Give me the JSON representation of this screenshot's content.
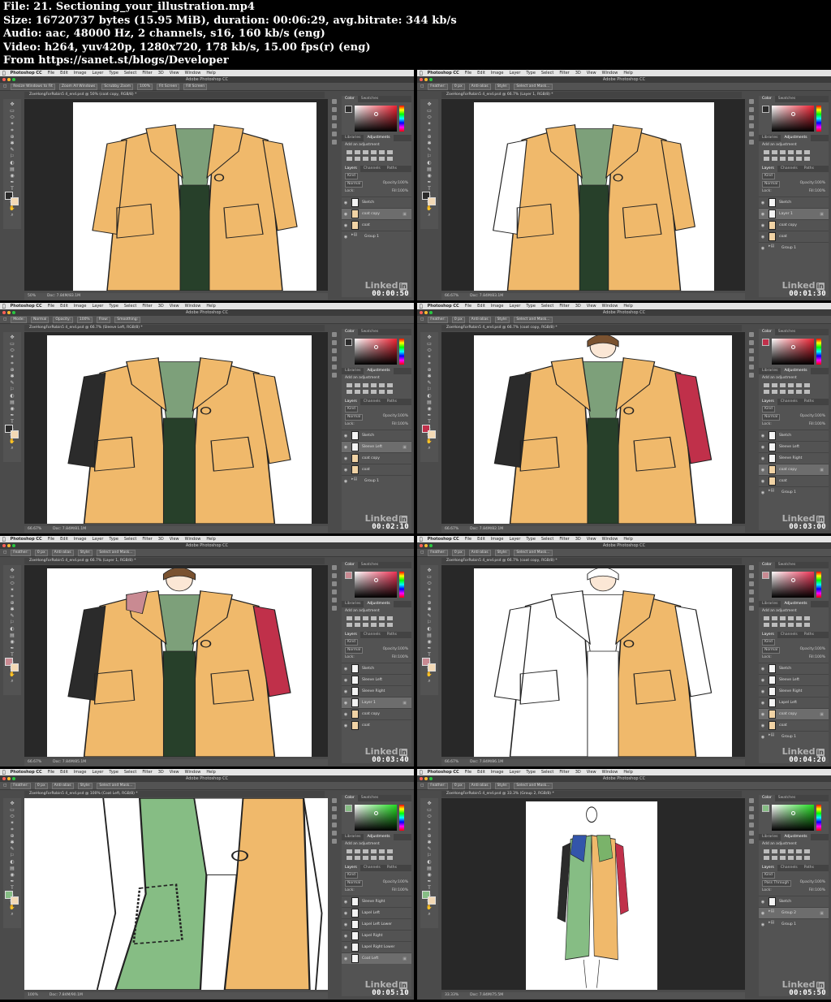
{
  "header": {
    "lines": [
      "File: 21. Sectioning_your_illustration.mp4",
      "Size: 16720737 bytes (15.95 MiB), duration: 00:06:29, avg.bitrate: 344 kb/s",
      "Audio: aac, 48000 Hz, 2 channels, s16, 160 kb/s (eng)",
      "Video: h264, yuv420p, 1280x720, 178 kb/s, 15.00 fps(r) (eng)",
      "From https://sanet.st/blogs/Developer"
    ]
  },
  "app": {
    "name": "Photoshop CC",
    "window_title": "Adobe Photoshop CC",
    "menu": [
      "File",
      "Edit",
      "Image",
      "Layer",
      "Type",
      "Select",
      "Filter",
      "3D",
      "View",
      "Window",
      "Help"
    ],
    "watermark": "Linked",
    "watermark_in": "in",
    "panel_tabs_top": [
      "Color",
      "Swatches"
    ],
    "panel_tabs_mid": [
      "Libraries",
      "Adjustments"
    ],
    "add_adjustment": "Add an adjustment",
    "panel_tabs_layers": [
      "Layers",
      "Channels",
      "Paths"
    ],
    "kind_label": "Kind",
    "opacity_label": "Opacity:",
    "opacity_value": "100%",
    "lock_label": "Lock:",
    "fill_label": "Fill:",
    "fill_value": "100%"
  },
  "frames": [
    {
      "timestamp": "00:00:50",
      "doc_tab": "ZoeHongForRobin5 4_end.psd @ 50% (coat copy, RGB/8) *",
      "zoom": "50%",
      "doc_size": "Doc: 7.84M/83.1M",
      "blend": "Normal",
      "options": [
        "Resize Windows to Fit",
        "Zoom All Windows",
        "Scrubby Zoom",
        "100%",
        "Fit Screen",
        "Fill Screen"
      ],
      "picker": "red",
      "fg": "#2b2b2b",
      "layers": [
        {
          "name": "Sketch",
          "type": "sketch"
        },
        {
          "name": "coat copy",
          "type": "coat",
          "selected": true
        },
        {
          "name": "coat",
          "type": "coat"
        },
        {
          "name": "Group 1",
          "type": "folder"
        }
      ]
    },
    {
      "timestamp": "00:01:30",
      "doc_tab": "ZoeHongForRobin5 4_end.psd @ 66.7% (Layer 1, RGB/8) *",
      "zoom": "66.67%",
      "doc_size": "Doc: 7.84M/83.1M",
      "blend": "Normal",
      "options": [
        "Feather:",
        "0 px",
        "Anti-alias",
        "Style:",
        "Select and Mask..."
      ],
      "picker": "red",
      "fg": "#2b2b2b",
      "layers": [
        {
          "name": "Sketch",
          "type": "sketch"
        },
        {
          "name": "Layer 1",
          "type": "sketch",
          "selected": true
        },
        {
          "name": "coat copy",
          "type": "coat"
        },
        {
          "name": "coat",
          "type": "coat"
        },
        {
          "name": "Group 1",
          "type": "folder"
        }
      ]
    },
    {
      "timestamp": "00:02:10",
      "doc_tab": "ZoeHongForRobin5 4_end.psd @ 66.7% (Sleeve Left, RGB/8) *",
      "zoom": "66.67%",
      "doc_size": "Doc: 7.84M/81.1M",
      "blend": "Normal",
      "options": [
        "Mode:",
        "Normal",
        "Opacity:",
        "100%",
        "Flow:",
        "Smoothing:"
      ],
      "picker": "red",
      "fg": "#2b2b2b",
      "layers": [
        {
          "name": "Sketch",
          "type": "sketch"
        },
        {
          "name": "Sleeve Left",
          "type": "sketch",
          "selected": true
        },
        {
          "name": "coat copy",
          "type": "coat"
        },
        {
          "name": "coat",
          "type": "coat"
        },
        {
          "name": "Group 1",
          "type": "folder"
        }
      ]
    },
    {
      "timestamp": "00:03:00",
      "doc_tab": "ZoeHongForRobin5 4_end.psd @ 66.7% (coat copy, RGB/8) *",
      "zoom": "66.67%",
      "doc_size": "Doc: 7.84M/82.1M",
      "blend": "Normal",
      "options": [
        "Feather:",
        "0 px",
        "Anti-alias",
        "Style:",
        "Select and Mask..."
      ],
      "picker": "red",
      "fg": "#c0304a",
      "layers": [
        {
          "name": "Sketch",
          "type": "sketch"
        },
        {
          "name": "Sleeve Left",
          "type": "sketch"
        },
        {
          "name": "Sleeve Right",
          "type": "sketch"
        },
        {
          "name": "coat copy",
          "type": "coat",
          "selected": true
        },
        {
          "name": "coat",
          "type": "coat"
        },
        {
          "name": "Group 1",
          "type": "folder"
        }
      ]
    },
    {
      "timestamp": "00:03:40",
      "doc_tab": "ZoeHongForRobin5 4_end.psd @ 66.7% (Layer 1, RGB/8) *",
      "zoom": "66.67%",
      "doc_size": "Doc: 7.84M/85.1M",
      "blend": "Normal",
      "options": [
        "Feather:",
        "0 px",
        "Anti-alias",
        "Style:",
        "Select and Mask..."
      ],
      "picker": "pink",
      "fg": "#c98a92",
      "layers": [
        {
          "name": "Sketch",
          "type": "sketch"
        },
        {
          "name": "Sleeve Left",
          "type": "sketch"
        },
        {
          "name": "Sleeve Right",
          "type": "sketch"
        },
        {
          "name": "Layer 1",
          "type": "sketch",
          "selected": true
        },
        {
          "name": "coat copy",
          "type": "coat"
        },
        {
          "name": "coat",
          "type": "coat"
        }
      ]
    },
    {
      "timestamp": "00:04:20",
      "doc_tab": "ZoeHongForRobin5 4_end.psd @ 66.7% (coat copy, RGB/8) *",
      "zoom": "66.67%",
      "doc_size": "Doc: 7.84M/86.1M",
      "blend": "Normal",
      "options": [
        "Feather:",
        "0 px",
        "Anti-alias",
        "Style:",
        "Select and Mask..."
      ],
      "picker": "pink",
      "fg": "#c98a92",
      "layers": [
        {
          "name": "Sketch",
          "type": "sketch"
        },
        {
          "name": "Sleeve Left",
          "type": "sketch"
        },
        {
          "name": "Sleeve Right",
          "type": "sketch"
        },
        {
          "name": "Lapel Left",
          "type": "sketch"
        },
        {
          "name": "coat copy",
          "type": "coat",
          "selected": true
        },
        {
          "name": "coat",
          "type": "coat"
        },
        {
          "name": "Group 1",
          "type": "folder"
        }
      ]
    },
    {
      "timestamp": "00:05:10",
      "doc_tab": "ZoeHongForRobin5 4_end.psd @ 100% (Coat Left, RGB/8) *",
      "zoom": "100%",
      "doc_size": "Doc: 7.84M/90.1M",
      "blend": "Normal",
      "options": [
        "Feather:",
        "0 px",
        "Anti-alias",
        "Style:",
        "Select and Mask..."
      ],
      "picker": "green",
      "fg": "#86bd84",
      "layers": [
        {
          "name": "Sleeve Right",
          "type": "sketch"
        },
        {
          "name": "Lapel Left",
          "type": "sketch"
        },
        {
          "name": "Lapel Left Lower",
          "type": "sketch"
        },
        {
          "name": "Lapel Right",
          "type": "sketch"
        },
        {
          "name": "Lapel Right Lower",
          "type": "sketch"
        },
        {
          "name": "Coat Left",
          "type": "sketch",
          "selected": true
        }
      ]
    },
    {
      "timestamp": "00:05:50",
      "doc_tab": "ZoeHongForRobin5 4_end.psd @ 33.3% (Group 2, RGB/8) *",
      "zoom": "33.33%",
      "doc_size": "Doc: 7.84M/75.5M",
      "blend": "Pass Through",
      "options": [
        "Feather:",
        "0 px",
        "Anti-alias",
        "Style:",
        "Select and Mask..."
      ],
      "picker": "green",
      "fg": "#86bd84",
      "layers": [
        {
          "name": "Sketch",
          "type": "sketch"
        },
        {
          "name": "Group 2",
          "type": "folder",
          "selected": true
        },
        {
          "name": "Group 1",
          "type": "folder"
        }
      ]
    }
  ]
}
